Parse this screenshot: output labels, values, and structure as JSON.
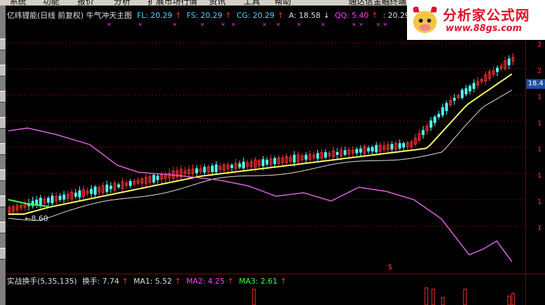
{
  "menu": {
    "items": [
      "系统",
      "功能",
      "报价",
      "分析",
      "扩展市场行情",
      "资讯",
      "工具",
      "帮助"
    ],
    "right_text": "通达信金融终端"
  },
  "header": {
    "title": "亿纬锂能(日线 前复权)",
    "indicator_name": "牛气冲天主图",
    "fl": "FL: 20.29",
    "fs": "FS: 20.29",
    "cg": "CG: 20.29",
    "a": "A: 18.58",
    "qq": "QQ: 5.40",
    "colon_val": ": 20.29",
    "up_arrow": "↑",
    "down_arrow": "↓"
  },
  "logo": {
    "title": "分析家公式网",
    "url": "www.88gs.com"
  },
  "price_tag": "18.4",
  "low_label": "←8.60",
  "sub": {
    "title": "实战换手(5,35,135)",
    "turnover": "换手: 7.74",
    "ma1": "MA1: 5.52",
    "ma2": "MA2: 4.25",
    "ma3": "MA3: 2.61",
    "up_arrow": "↑"
  },
  "sub_marker": "$",
  "axis_digits": [
    "2",
    "2",
    "1",
    "1",
    "1",
    "1",
    "1",
    "1"
  ],
  "colors": {
    "up": "#ff3232",
    "down": "#54ffff",
    "ma_main": "#ffff66",
    "boll": "#e0e0e0",
    "purple": "#e060e0",
    "grid": "#8b0000"
  }
}
